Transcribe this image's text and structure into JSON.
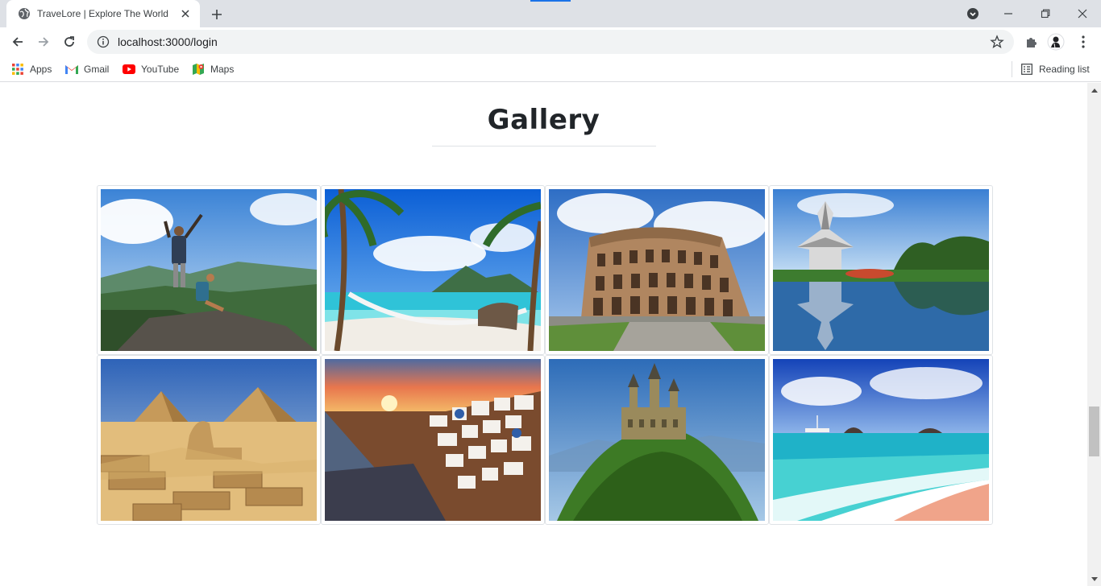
{
  "browser": {
    "tab_title": "TraveLore | Explore The World",
    "url": "localhost:3000/login",
    "bookmarks": [
      "Apps",
      "Gmail",
      "YouTube",
      "Maps"
    ],
    "reading_list": "Reading list"
  },
  "page": {
    "title": "Gallery",
    "gallery": [
      {
        "scene": "hikers-on-mountain"
      },
      {
        "scene": "tropical-beach-hammock"
      },
      {
        "scene": "colosseum"
      },
      {
        "scene": "thai-temple-reflection"
      },
      {
        "scene": "pyramids-sphinx"
      },
      {
        "scene": "santorini-sunset"
      },
      {
        "scene": "hilltop-castle"
      },
      {
        "scene": "turquoise-beach"
      }
    ]
  },
  "colors": {
    "accent": "#1a73e8",
    "chrome_bg": "#dee1e6",
    "title": "#212529"
  }
}
